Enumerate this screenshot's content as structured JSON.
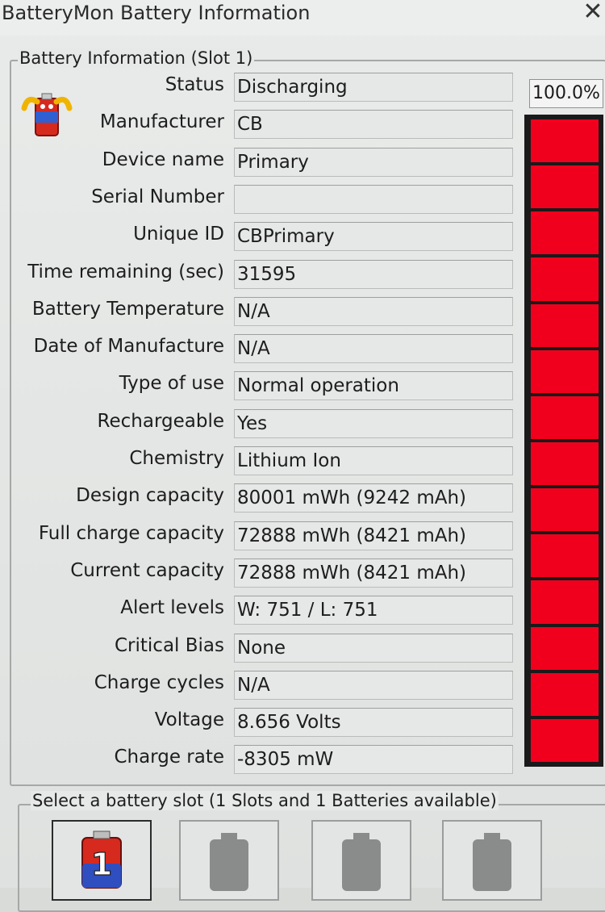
{
  "window": {
    "title": "BatteryMon Battery Information",
    "close_label": "✕"
  },
  "info_group": {
    "label": "Battery Information (Slot 1)",
    "percent": "100.0%",
    "charge_level": 1.0,
    "segments": 14,
    "meter_color": "#f1001d",
    "rows": [
      {
        "label": "Status",
        "value": "Discharging"
      },
      {
        "label": "Manufacturer",
        "value": "CB"
      },
      {
        "label": "Device name",
        "value": "Primary"
      },
      {
        "label": "Serial Number",
        "value": ""
      },
      {
        "label": "Unique ID",
        "value": "CBPrimary"
      },
      {
        "label": "Time remaining (sec)",
        "value": "31595"
      },
      {
        "label": "Battery Temperature",
        "value": "N/A"
      },
      {
        "label": "Date of Manufacture",
        "value": "N/A"
      },
      {
        "label": "Type of use",
        "value": "Normal operation"
      },
      {
        "label": "Rechargeable",
        "value": "Yes"
      },
      {
        "label": "Chemistry",
        "value": "Lithium Ion"
      },
      {
        "label": "Design capacity",
        "value": "80001 mWh (9242 mAh)"
      },
      {
        "label": "Full charge capacity",
        "value": "72888 mWh (8421 mAh)"
      },
      {
        "label": "Current capacity",
        "value": "72888 mWh (8421 mAh)"
      },
      {
        "label": "Alert levels",
        "value": "W: 751 / L: 751"
      },
      {
        "label": "Critical Bias",
        "value": "None"
      },
      {
        "label": "Charge cycles",
        "value": "N/A"
      },
      {
        "label": "Voltage",
        "value": "8.656 Volts"
      },
      {
        "label": "Charge rate",
        "value": "-8305 mW"
      }
    ]
  },
  "slot_group": {
    "label": "Select a battery slot (1 Slots and 1 Batteries available)",
    "slots": [
      {
        "icon": "battery-slot-1-icon",
        "badge": "1",
        "active": true
      },
      {
        "icon": "empty-slot-icon",
        "active": false
      },
      {
        "icon": "empty-slot-icon",
        "active": false
      },
      {
        "icon": "empty-slot-icon",
        "active": false
      }
    ]
  }
}
